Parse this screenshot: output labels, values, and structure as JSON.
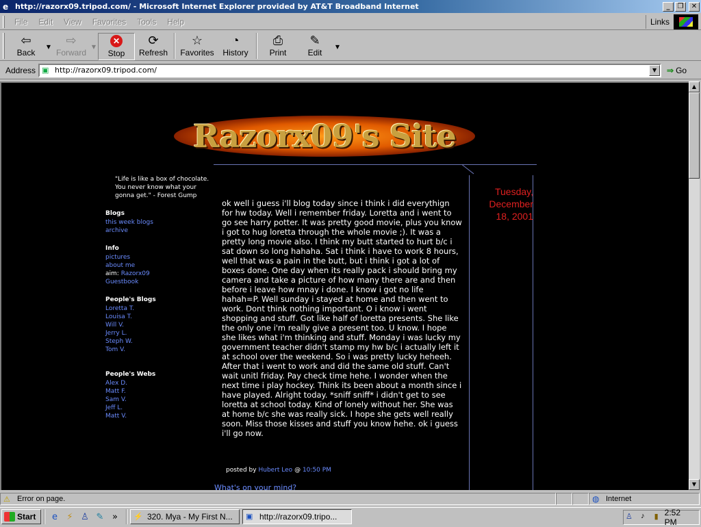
{
  "window": {
    "title": "http://razorx09.tripod.com/ - Microsoft Internet Explorer provided by AT&T Broadband Internet",
    "minimize": "_",
    "restore": "❐",
    "close": "✕"
  },
  "menu": {
    "items": [
      "File",
      "Edit",
      "View",
      "Favorites",
      "Tools",
      "Help"
    ],
    "links": "Links"
  },
  "toolbar": {
    "back": "Back",
    "forward": "Forward",
    "stop": "Stop",
    "refresh": "Refresh",
    "favorites": "Favorites",
    "history": "History",
    "print": "Print",
    "edit": "Edit"
  },
  "address": {
    "label": "Address",
    "url": "http://razorx09.tripod.com/",
    "go": "Go"
  },
  "page": {
    "banner": "Razorx09's Site",
    "quote": "\"Life is like a box of chocolate. You never know what your gonna get.\" - Forest Gump",
    "blogs": {
      "heading": "Blogs",
      "links": [
        "this week blogs",
        "archive"
      ]
    },
    "info": {
      "heading": "Info",
      "links": [
        "pictures",
        "about me"
      ],
      "aim_label": "aim: ",
      "aim_value": "Razorx09",
      "guestbook": "Guestbook"
    },
    "peoples_blogs": {
      "heading": "People's Blogs",
      "links": [
        "Loretta T.",
        "Louisa T.",
        "Will V.",
        "Jerry L.",
        "Steph W.",
        "Tom V."
      ]
    },
    "peoples_webs": {
      "heading": "People's Webs",
      "links": [
        "Alex D.",
        "Matt F.",
        "Sam V.",
        "Jeff L.",
        "Matt V."
      ]
    },
    "date": "Tuesday,\nDecember\n18, 2001",
    "post_body": "ok well i guess i'll blog today since i think i did everythign for hw today. Well i remember friday. Loretta and i went to go see harry potter. It was pretty good movie, plus you know i got to hug loretta through the whole movie ;). It was a pretty long movie also. I think my butt started to hurt b/c i sat down so long hahaha. Sat i think i have to work 8 hours, well that was a pain in the butt, but i think i got a lot of boxes done. One day when its really pack i should bring my camera and take a picture of how many there are and then before i leave how mnay i done. I know i got no life hahah=P. Well sunday i stayed at home and then went to work. Dont think nothing important. O i know i went shopping and stuff. Got like half of loretta presents. She like the only one i'm really give a present too. U know. I hope she likes what i'm thinking and stuff. Monday i was lucky my government teacher didn't stamp my hw b/c i actually left it at school over the weekend. So i was pretty lucky heheeh. After that i went to work and did the same old stuff. Can't wait unitl friday. Pay check time hehe. I wonder when the next time i play hockey. Think its been about a month since i have played. Alright today. *sniff sniff* i didn't get to see loretta at school today. Kind of lonely without her. She was at home b/c she was really sick. I hope she gets well really soon. Miss those kisses and stuff you know hehe. ok i guess i'll go now.",
    "posted_by_label": "posted by",
    "author": "Hubert Leo",
    "at": "@",
    "time": "10:50 PM",
    "mind_link": "What's on your mind?"
  },
  "status": {
    "message": "Error on page.",
    "zone": "Internet"
  },
  "taskbar": {
    "start": "Start",
    "chevron": "»",
    "tasks": [
      "320. Mya - My First N...",
      "http://razorx09.tripo..."
    ],
    "clock": "2:52 PM"
  }
}
